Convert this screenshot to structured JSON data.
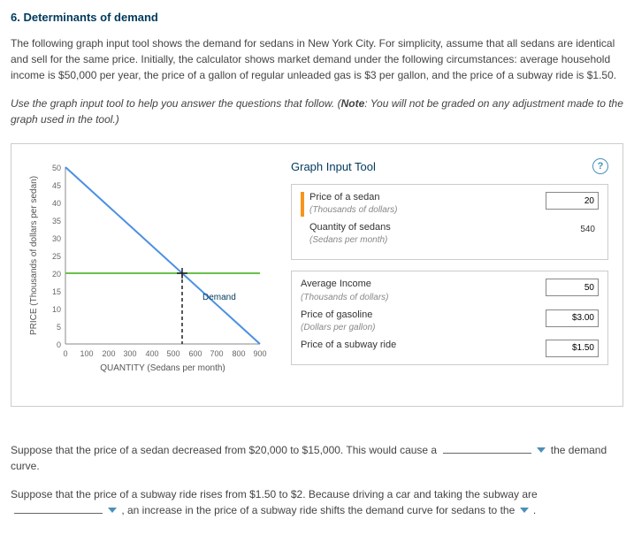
{
  "title": "6. Determinants of demand",
  "para1": "The following graph input tool shows the demand for sedans in New York City. For simplicity, assume that all sedans are identical and sell for the same price. Initially, the calculator shows market demand under the following circumstances: average household income is $50,000 per year, the price of a gallon of regular unleaded gas is $3 per gallon, and the price of a subway ride is $1.50.",
  "instr_a": "Use the graph input tool to help you answer the questions that follow. (",
  "instr_note_label": "Note",
  "instr_b": ": You will not be graded on any adjustment made to the graph used in the tool.)",
  "panel": {
    "title": "Graph Input Tool",
    "help": "?",
    "price_label": "Price of a sedan",
    "price_sub": "(Thousands of dollars)",
    "price_val": "20",
    "qty_label": "Quantity of sedans",
    "qty_sub": "(Sedans per month)",
    "qty_val": "540",
    "income_label": "Average Income",
    "income_sub": "(Thousands of dollars)",
    "income_val": "50",
    "gas_label": "Price of gasoline",
    "gas_sub": "(Dollars per gallon)",
    "gas_val": "$3.00",
    "subway_label": "Price of a subway ride",
    "subway_val": "$1.50"
  },
  "chart_data": {
    "type": "line",
    "title": "",
    "xlabel": "QUANTITY (Sedans per month)",
    "ylabel": "PRICE (Thousands of dollars per sedan)",
    "x_ticks": [
      0,
      100,
      200,
      300,
      400,
      500,
      600,
      700,
      800,
      900
    ],
    "y_ticks": [
      0,
      5,
      10,
      15,
      20,
      25,
      30,
      35,
      40,
      45,
      50
    ],
    "xlim": [
      0,
      900
    ],
    "ylim": [
      0,
      50
    ],
    "series": [
      {
        "name": "Demand",
        "color": "#4a90e2",
        "points": [
          [
            0,
            50
          ],
          [
            900,
            0
          ]
        ]
      }
    ],
    "guides": {
      "price_line_y": 20,
      "qty_line_x": 540
    },
    "legend": {
      "demand": "Demand"
    }
  },
  "q1_a": "Suppose that the price of a sedan decreased from $20,000 to $15,000. This would cause a ",
  "q1_b": " the demand curve.",
  "q2_a": "Suppose that the price of a subway ride rises from $1.50 to $2. Because driving a car and taking the subway are ",
  "q2_b": " , an increase in the price of a subway ride shifts the demand curve for sedans to the ",
  "q2_c": " ."
}
